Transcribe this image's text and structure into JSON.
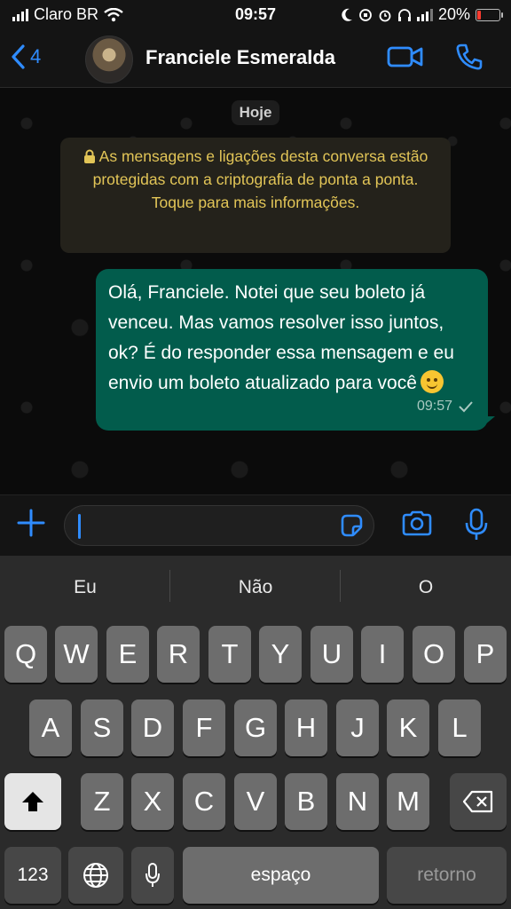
{
  "status_bar": {
    "carrier": "Claro BR",
    "time": "09:57",
    "battery_text": "20%",
    "battery_level": 0.2,
    "battery_color": "#ff3b30"
  },
  "header": {
    "back_count": "4",
    "contact_name": "Franciele Esmeralda",
    "icons": [
      "back-chevron-icon",
      "video-call-icon",
      "phone-call-icon"
    ],
    "accent_color": "#2f8cff"
  },
  "chat": {
    "date_label": "Hoje",
    "encryption_notice": "As mensagens e ligações desta conversa estão protegidas com a criptografia de ponta a ponta. Toque para mais informações.",
    "messages": [
      {
        "text": "Olá, Franciele. Notei que seu boleto já venceu. Mas vamos resolver isso juntos, ok?  É do responder essa mensagem e eu envio um boleto atualizado para você",
        "emoji": "smiling-face",
        "time": "09:57",
        "status": "sent",
        "bubble_color": "#025c4c"
      }
    ]
  },
  "composer": {
    "value": "",
    "icons": [
      "plus-icon",
      "sticker-icon",
      "camera-icon",
      "microphone-icon"
    ]
  },
  "keyboard": {
    "suggestions": [
      "Eu",
      "Não",
      "O"
    ],
    "row1": [
      "Q",
      "W",
      "E",
      "R",
      "T",
      "Y",
      "U",
      "I",
      "O",
      "P"
    ],
    "row2": [
      "A",
      "S",
      "D",
      "F",
      "G",
      "H",
      "J",
      "K",
      "L"
    ],
    "row3": [
      "Z",
      "X",
      "C",
      "V",
      "B",
      "N",
      "M"
    ],
    "numbers_key": "123",
    "space_key": "espaço",
    "return_key": "retorno"
  }
}
